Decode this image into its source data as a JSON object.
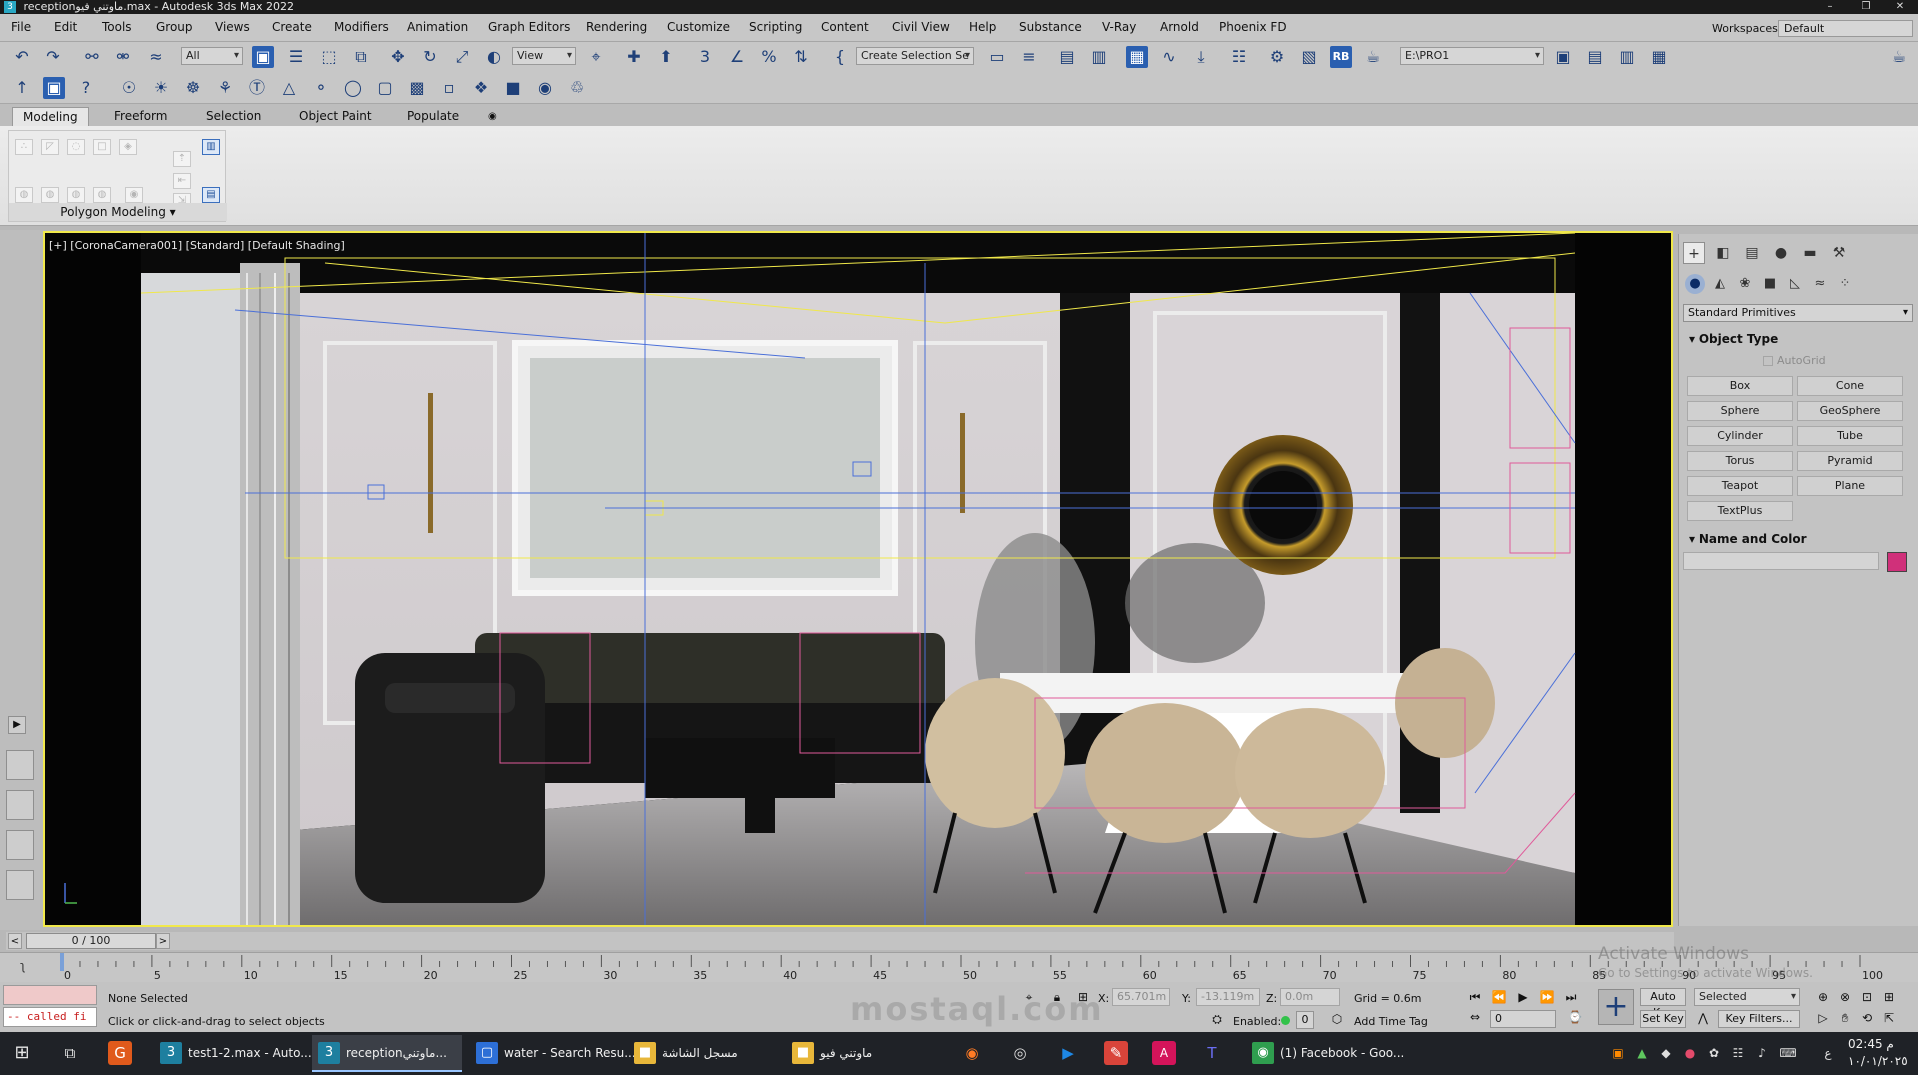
{
  "window": {
    "title": "receptionماوتني فيو.max - Autodesk 3ds Max 2022",
    "min_glyph": "–",
    "max_glyph": "❒",
    "close_glyph": "✕",
    "app_icon_glyph": "3"
  },
  "menu": [
    "File",
    "Edit",
    "Tools",
    "Group",
    "Views",
    "Create",
    "Modifiers",
    "Animation",
    "Graph Editors",
    "Rendering",
    "Customize",
    "Scripting",
    "Content",
    "Civil View",
    "Help",
    "Substance",
    "V-Ray",
    "Arnold",
    "Phoenix FD"
  ],
  "workspaces": {
    "label": "Workspaces:",
    "value": "Default"
  },
  "toolbar": {
    "selection_filter": "All",
    "reference_coord": "View",
    "named_selection": "Create Selection Se",
    "project_path": "E:\\PRO1",
    "icons": [
      {
        "name": "undo-icon",
        "glyph": "↶"
      },
      {
        "name": "redo-icon",
        "glyph": "↷"
      },
      {
        "name": "link-icon",
        "glyph": "⚯"
      },
      {
        "name": "unlink-icon",
        "glyph": "⚮"
      },
      {
        "name": "bind-space-warp-icon",
        "glyph": "≈"
      },
      {
        "name": "select-object-icon",
        "glyph": "▣"
      },
      {
        "name": "select-by-name-icon",
        "glyph": "☰"
      },
      {
        "name": "rect-selection-region-icon",
        "glyph": "⬚"
      },
      {
        "name": "window-crossing-icon",
        "glyph": "⧉"
      },
      {
        "name": "select-move-icon",
        "glyph": "✥"
      },
      {
        "name": "select-rotate-icon",
        "glyph": "↻"
      },
      {
        "name": "select-scale-icon",
        "glyph": "⤢"
      },
      {
        "name": "select-place-icon",
        "glyph": "◐"
      },
      {
        "name": "use-pivot-center-icon",
        "glyph": "⌖"
      },
      {
        "name": "select-manipulate-icon",
        "glyph": "✚"
      },
      {
        "name": "keyboard-shortcut-icon",
        "glyph": "⬆"
      },
      {
        "name": "snaps-toggle-icon",
        "glyph": "3"
      },
      {
        "name": "angle-snap-icon",
        "glyph": "∠"
      },
      {
        "name": "percent-snap-icon",
        "glyph": "%"
      },
      {
        "name": "spinner-snap-icon",
        "glyph": "⇅"
      },
      {
        "name": "edit-named-selection-icon",
        "glyph": "{"
      },
      {
        "name": "mirror-icon",
        "glyph": "▭"
      },
      {
        "name": "align-icon",
        "glyph": "≡"
      },
      {
        "name": "layer-explorer-icon",
        "glyph": "▤"
      },
      {
        "name": "scene-explorer-icon",
        "glyph": "▥"
      },
      {
        "name": "ribbon-toggle-icon",
        "glyph": "▦"
      },
      {
        "name": "curve-editor-icon",
        "glyph": "∿"
      },
      {
        "name": "schematic-view-icon",
        "glyph": "⤓"
      },
      {
        "name": "material-editor-icon",
        "glyph": "☷"
      },
      {
        "name": "render-setup-icon",
        "glyph": "⚙"
      },
      {
        "name": "rendered-frame-icon",
        "glyph": "▧"
      },
      {
        "name": "render-production-icon",
        "glyph": "RB"
      },
      {
        "name": "render-iterative-icon",
        "glyph": "☕"
      }
    ],
    "row2_icons": [
      {
        "name": "ik-solver-icon",
        "glyph": "↑"
      },
      {
        "name": "active-view-icon",
        "glyph": "▣"
      },
      {
        "name": "help-icon",
        "glyph": "?"
      },
      {
        "name": "light-icon",
        "glyph": "☉"
      },
      {
        "name": "sun-icon",
        "glyph": "☀"
      },
      {
        "name": "corona-icon",
        "glyph": "☸"
      },
      {
        "name": "plant-icon",
        "glyph": "⚘"
      },
      {
        "name": "text-icon",
        "glyph": "Ⓣ"
      },
      {
        "name": "cone-icon",
        "glyph": "△"
      },
      {
        "name": "bulb-icon",
        "glyph": "⚬"
      },
      {
        "name": "sphere-icon",
        "glyph": "◯"
      },
      {
        "name": "render-region-icon",
        "glyph": "▢"
      },
      {
        "name": "proxy-icon",
        "glyph": "▩"
      },
      {
        "name": "frame-buffer-icon",
        "glyph": "▫"
      },
      {
        "name": "converter-icon",
        "glyph": "❖"
      },
      {
        "name": "camera-icon",
        "glyph": "■"
      },
      {
        "name": "eye-icon",
        "glyph": "◉"
      },
      {
        "name": "lamp-icon",
        "glyph": "♲"
      }
    ]
  },
  "ribbon": {
    "tabs": [
      "Modeling",
      "Freeform",
      "Selection",
      "Object Paint",
      "Populate"
    ],
    "active_tab": "Modeling",
    "group_label": "Polygon Modeling",
    "options_glyph": "◉"
  },
  "viewport": {
    "label": "[+] [CoronaCamera001] [Standard] [Default Shading]",
    "frame_color": "#f0e84a"
  },
  "command_panel": {
    "tab_glyphs": [
      "+",
      "◧",
      "▤",
      "●",
      "▬",
      "⚒"
    ],
    "sub_glyphs": [
      "●",
      "◭",
      "❀",
      "■",
      "◺",
      "≈",
      "⁘"
    ],
    "category": "Standard Primitives",
    "object_type_header": "Object Type",
    "autogrid_label": "AutoGrid",
    "buttons": [
      "Box",
      "Cone",
      "Sphere",
      "GeoSphere",
      "Cylinder",
      "Tube",
      "Torus",
      "Pyramid",
      "Teapot",
      "Plane",
      "TextPlus"
    ],
    "name_color_header": "Name and Color",
    "object_color": "#d0307a"
  },
  "timeline": {
    "frame_display": "0 / 100",
    "prev_glyph": "<",
    "next_glyph": ">",
    "ticks": [
      0,
      5,
      10,
      15,
      20,
      25,
      30,
      35,
      40,
      45,
      50,
      55,
      60,
      65,
      70,
      75,
      80,
      85,
      90,
      95,
      100
    ],
    "current_frame": 0
  },
  "status": {
    "maxscript_text": "-- called fi",
    "selection_status": "None Selected",
    "prompt": "Click or click-and-drag to select objects",
    "x_label": "X:",
    "x_value": "65.701m",
    "y_label": "Y:",
    "y_value": "-13.119m",
    "z_label": "Z:",
    "z_value": "0.0m",
    "grid": "Grid = 0.6m",
    "enabled_label": "Enabled:",
    "enabled_value": "0",
    "add_time_tag": "Add Time Tag",
    "auto_key": "Auto Key",
    "set_key": "Set Key",
    "selected_value": "Selected",
    "key_filters": "Key Filters...",
    "current_frame_field": "0",
    "playback": [
      "⏮",
      "⏪",
      "▶",
      "⏩",
      "⏭"
    ],
    "big_key_glyph": "+"
  },
  "watermark": {
    "site": "mostaql.com",
    "activate_title": "Activate Windows",
    "activate_sub": "Go to Settings to activate Windows."
  },
  "taskbar": {
    "start_glyph": "⊞",
    "taskview_glyph": "⧉",
    "apps": [
      {
        "label": "test1-2.max - Auto...",
        "icon": "3",
        "color": "#1e7f9f",
        "active": false
      },
      {
        "label": "receptionماوتني...",
        "icon": "3",
        "color": "#1e7f9f",
        "active": true
      },
      {
        "label": "water - Search Resu...",
        "icon": "▢",
        "color": "#2d6fd6",
        "active": false
      },
      {
        "label": "مسجل الشاشة",
        "icon": "■",
        "color": "#e8b73a",
        "active": false
      },
      {
        "label": "ماوتني فيو",
        "icon": "■",
        "color": "#e8b73a",
        "active": false
      },
      {
        "label": "(1) Facebook - Goo...",
        "icon": "◉",
        "color": "#2f9e4f",
        "active": false
      }
    ],
    "clock_time": "م 02:45",
    "clock_date": "١٠/٠١/٢٠٢٥",
    "lang": "ع"
  }
}
